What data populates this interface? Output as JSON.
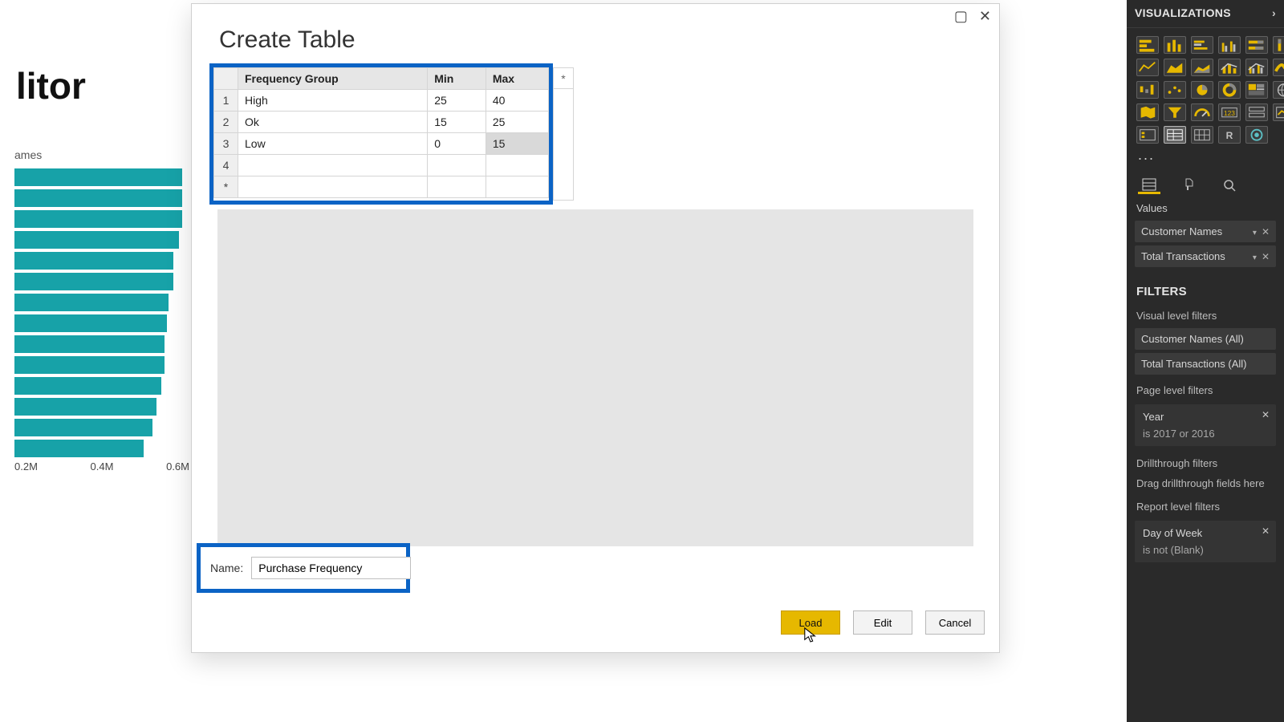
{
  "panel": {
    "title": "VISUALIZATIONS",
    "more": "...",
    "values_label": "Values",
    "filters_title": "FILTERS",
    "visual_label": "Visual level filters",
    "page_label": "Page level filters",
    "drillthrough_label": "Drillthrough filters",
    "drill_hint": "Drag drillthrough fields here",
    "report_label": "Report level filters",
    "fields": {
      "f0": "Customer Names",
      "f1": "Total Transactions"
    },
    "vfilters": {
      "v0": "Customer Names (All)",
      "v1": "Total Transactions (All)"
    },
    "page_filter": {
      "name": "Year",
      "cond": "is 2017 or 2016"
    },
    "report_filter": {
      "name": "Day of Week",
      "cond": "is not (Blank)"
    }
  },
  "bg": {
    "title": "litor",
    "sub": "ames",
    "axis": {
      "a": "0.2M",
      "b": "0.4M",
      "c": "0.6M"
    }
  },
  "dialog": {
    "title": "Create Table",
    "name_label": "Name:",
    "name_value": "Purchase Frequency",
    "extra_col_header": "*",
    "buttons": {
      "load": "Load",
      "edit": "Edit",
      "cancel": "Cancel"
    },
    "table": {
      "headers": {
        "c0": "Frequency Group",
        "c1": "Min",
        "c2": "Max"
      },
      "rows": {
        "r1": {
          "n": "1",
          "g": "High",
          "min": "25",
          "max": "40"
        },
        "r2": {
          "n": "2",
          "g": "Ok",
          "min": "15",
          "max": "25"
        },
        "r3": {
          "n": "3",
          "g": "Low",
          "min": "0",
          "max": "15"
        },
        "r4": {
          "n": "4",
          "g": "",
          "min": "",
          "max": ""
        },
        "rstar": {
          "n": "*",
          "g": "",
          "min": "",
          "max": ""
        }
      }
    }
  },
  "chart_data": {
    "type": "bar",
    "orientation": "horizontal",
    "title": "litor",
    "xlabel": "",
    "ylabel": "ames",
    "xlim": [
      0,
      0.6
    ],
    "x_ticks": [
      "0.2M",
      "0.4M",
      "0.6M"
    ],
    "categories": [
      "",
      "",
      "",
      "",
      "",
      "",
      "",
      "",
      "",
      "",
      "",
      "",
      "",
      ""
    ],
    "values": [
      0.56,
      0.56,
      0.56,
      0.55,
      0.53,
      0.53,
      0.51,
      0.51,
      0.5,
      0.5,
      0.49,
      0.47,
      0.46,
      0.43
    ],
    "note": "Chart is partially obscured by dialog; values estimated from visible bar lengths in millions."
  }
}
